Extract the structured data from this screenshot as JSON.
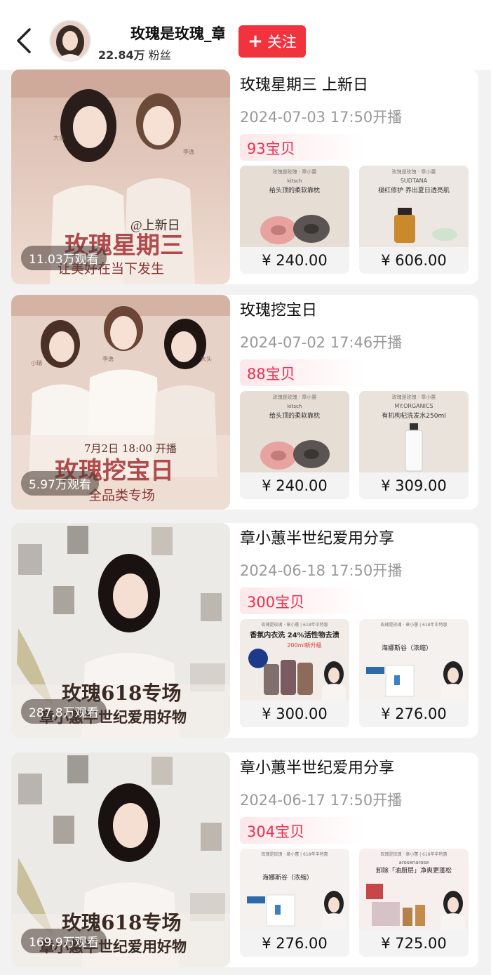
{
  "header": {
    "name": "玫瑰是玫瑰_章",
    "fans_count": "22.84万",
    "fans_label": "粉丝",
    "follow_label": "关注"
  },
  "streams": [
    {
      "title": "玫瑰星期三 上新日",
      "date": "2024-07-03 17:50开播",
      "count": "93宝贝",
      "views": "11.03万观看",
      "cover_lines": [
        "玫瑰星期三",
        "让美好在当下发生",
        "@上新日"
      ],
      "cover_names": [
        "大头",
        "李逸"
      ],
      "products": [
        {
          "price": "¥ 240.00",
          "header": "玫瑰是玫瑰 · 章小蕙",
          "brand": "kitsch",
          "caption": "给头顶的柔软靠枕"
        },
        {
          "price": "¥ 606.00",
          "header": "玫瑰是玫瑰 · 章小蕙",
          "brand": "SUDTANA",
          "caption": "褪红修护 养出夏日透亮肌"
        }
      ]
    },
    {
      "title": "玫瑰挖宝日",
      "date": "2024-07-02 17:46开播",
      "count": "88宝贝",
      "views": "5.97万观看",
      "cover_lines": [
        "玫瑰挖宝日",
        "全品类专场",
        "7月2日 18:00 开播"
      ],
      "cover_names": [
        "小瑞",
        "李逸",
        "大头"
      ],
      "products": [
        {
          "price": "¥ 240.00",
          "header": "玫瑰是玫瑰 · 章小蕙",
          "brand": "kitsch",
          "caption": "给头顶的柔软靠枕"
        },
        {
          "price": "¥ 309.00",
          "header": "玫瑰是玫瑰 · 章小蕙",
          "brand": "MY.ORGANICS",
          "caption": "有机枸杞洗发水250ml"
        }
      ]
    },
    {
      "title": "章小蕙半世纪爱用分享",
      "date": "2024-06-18 17:50开播",
      "count": "300宝贝",
      "views": "287.8万观看",
      "cover_lines": [
        "玫瑰618专场",
        "章小蕙半世纪爱用好物"
      ],
      "products": [
        {
          "price": "¥ 300.00",
          "header": "玫瑰是玫瑰 · 章小蕙 | 618年中特惠",
          "caption": "香氛内衣洗 24%活性物去渍",
          "sub": "200ml新升级"
        },
        {
          "price": "¥ 276.00",
          "header": "玫瑰是玫瑰 · 章小蕙 | 618年中特惠",
          "caption": "海娜斯谷（浓缩）"
        }
      ]
    },
    {
      "title": "章小蕙半世纪爱用分享",
      "date": "2024-06-17 17:50开播",
      "count": "304宝贝",
      "views": "169.9万观看",
      "cover_lines": [
        "玫瑰618专场",
        "章小蕙半世纪爱用好物"
      ],
      "products": [
        {
          "price": "¥ 276.00",
          "header": "玫瑰是玫瑰 · 章小蕙 | 618年中特惠",
          "caption": "海娜斯谷（浓缩）"
        },
        {
          "price": "¥ 725.00",
          "header": "玫瑰是玫瑰 · 章小蕙 | 618年中特惠",
          "brand": "arosenarose",
          "caption": "卸除「油厨层」净爽更蓬松"
        }
      ]
    }
  ],
  "colors": {
    "accent": "#f0333d",
    "count_text": "#e8304f",
    "muted": "#999999"
  }
}
